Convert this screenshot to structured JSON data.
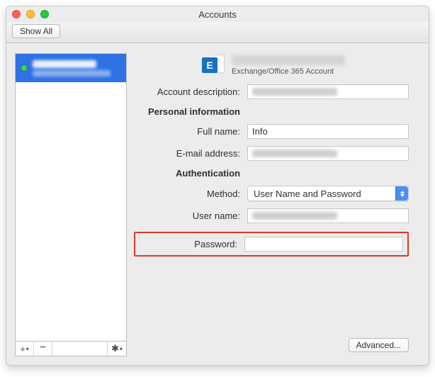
{
  "window": {
    "title": "Accounts"
  },
  "toolbar": {
    "show_all_label": "Show All"
  },
  "sidebar": {
    "footer": {
      "add": "+",
      "remove": "−",
      "gear": "✱",
      "caret": "▾"
    }
  },
  "header": {
    "icon_letter": "E",
    "subtitle": "Exchange/Office 365 Account"
  },
  "form": {
    "account_description_label": "Account description:",
    "personal_info_label": "Personal information",
    "full_name_label": "Full name:",
    "full_name_value": "Info",
    "email_label": "E-mail address:",
    "authentication_label": "Authentication",
    "method_label": "Method:",
    "method_value": "User Name and Password",
    "username_label": "User name:",
    "password_label": "Password:"
  },
  "footer": {
    "advanced_label": "Advanced..."
  }
}
